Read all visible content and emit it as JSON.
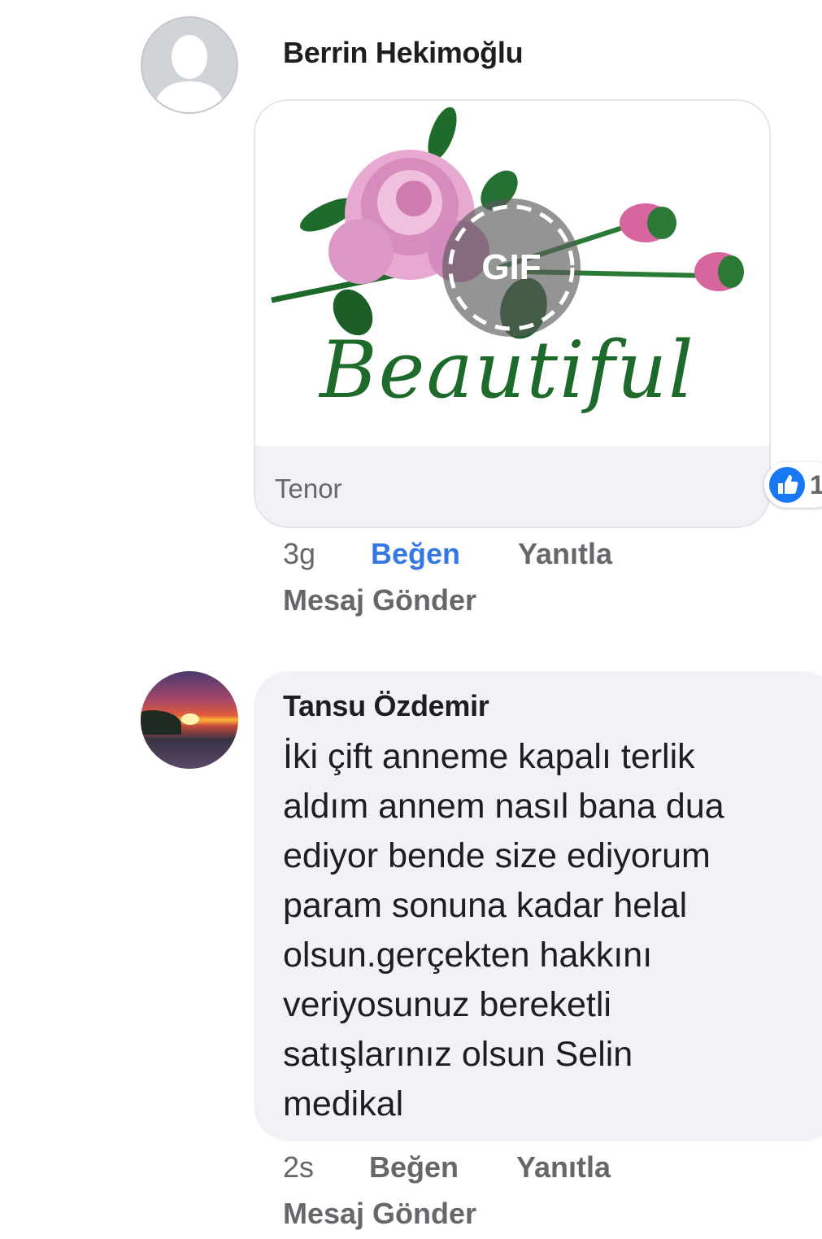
{
  "comments": [
    {
      "author": "Berrin Hekimoğlu",
      "gif": {
        "badge": "GIF",
        "caption": "Beautiful",
        "source": "Tenor"
      },
      "reaction_count": "1",
      "time": "3g",
      "like_label": "Beğen",
      "reply_label": "Yanıtla",
      "message_label": "Mesaj Gönder",
      "liked": true
    },
    {
      "author": "Tansu Özdemir",
      "text_lines": [
        "İki çift anneme kapalı terlik",
        "aldım annem nasıl bana dua",
        "ediyor bende size ediyorum",
        "param sonuna kadar helal",
        "olsun.gerçekten hakkını",
        "veriyosunuz bereketli",
        "satışlarınız olsun Selin",
        "medikal"
      ],
      "time": "2s",
      "like_label": "Beğen",
      "reply_label": "Yanıtla",
      "message_label": "Mesaj Gönder",
      "liked": false
    }
  ],
  "colors": {
    "liked_blue": "#3578e5",
    "bubble_bg": "#f0f2f5",
    "secondary_text": "#65676b",
    "primary_text": "#1c1e21"
  }
}
